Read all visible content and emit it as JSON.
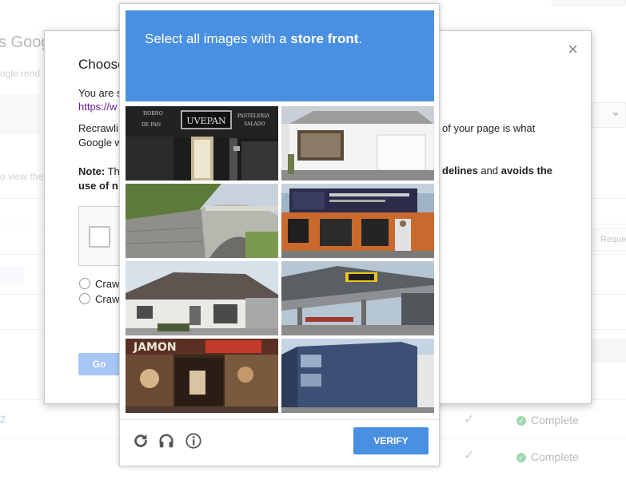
{
  "background": {
    "title": "s Goog",
    "subtitle": "ogle rend",
    "view_text": "o view the",
    "request_label": "Reque",
    "link_text": "2",
    "rows": [
      {
        "status": "Complete"
      },
      {
        "status": "Complete"
      }
    ]
  },
  "modal": {
    "title": "Choose",
    "line1": "You are s",
    "url": "https://w",
    "para_left_1": "Recrawli",
    "para_left_2": "Google w",
    "para_right": "of your page is what",
    "note_label": "Note:",
    "note_left": " Th",
    "note_left_2": "use of n",
    "note_right_bold1": "delines",
    "note_right_mid": " and ",
    "note_right_bold2": "avoids the",
    "radio_1": "Craw",
    "radio_2": "Craw",
    "go_label": "Go",
    "close_glyph": "×"
  },
  "captcha": {
    "instruction_prefix": "Select all images with a ",
    "instruction_target": "store front",
    "instruction_suffix": ".",
    "verify_label": "VERIFY",
    "tiles": [
      {
        "sign_1": "UVEPAN",
        "sign_2": "HORNO",
        "sign_3": "DE PAN",
        "sign_4": "PASTELERIA",
        "sign_5": "SALADO"
      },
      {},
      {},
      {},
      {},
      {},
      {
        "sign_1": "JAMON"
      },
      {}
    ],
    "icons": [
      "reload-icon",
      "headphones-icon",
      "info-icon"
    ]
  },
  "colors": {
    "captcha_blue": "#4a90e2",
    "go_disabled": "#a8c6f5",
    "complete_green": "#33a852",
    "link_purple": "#6a1b9a"
  }
}
